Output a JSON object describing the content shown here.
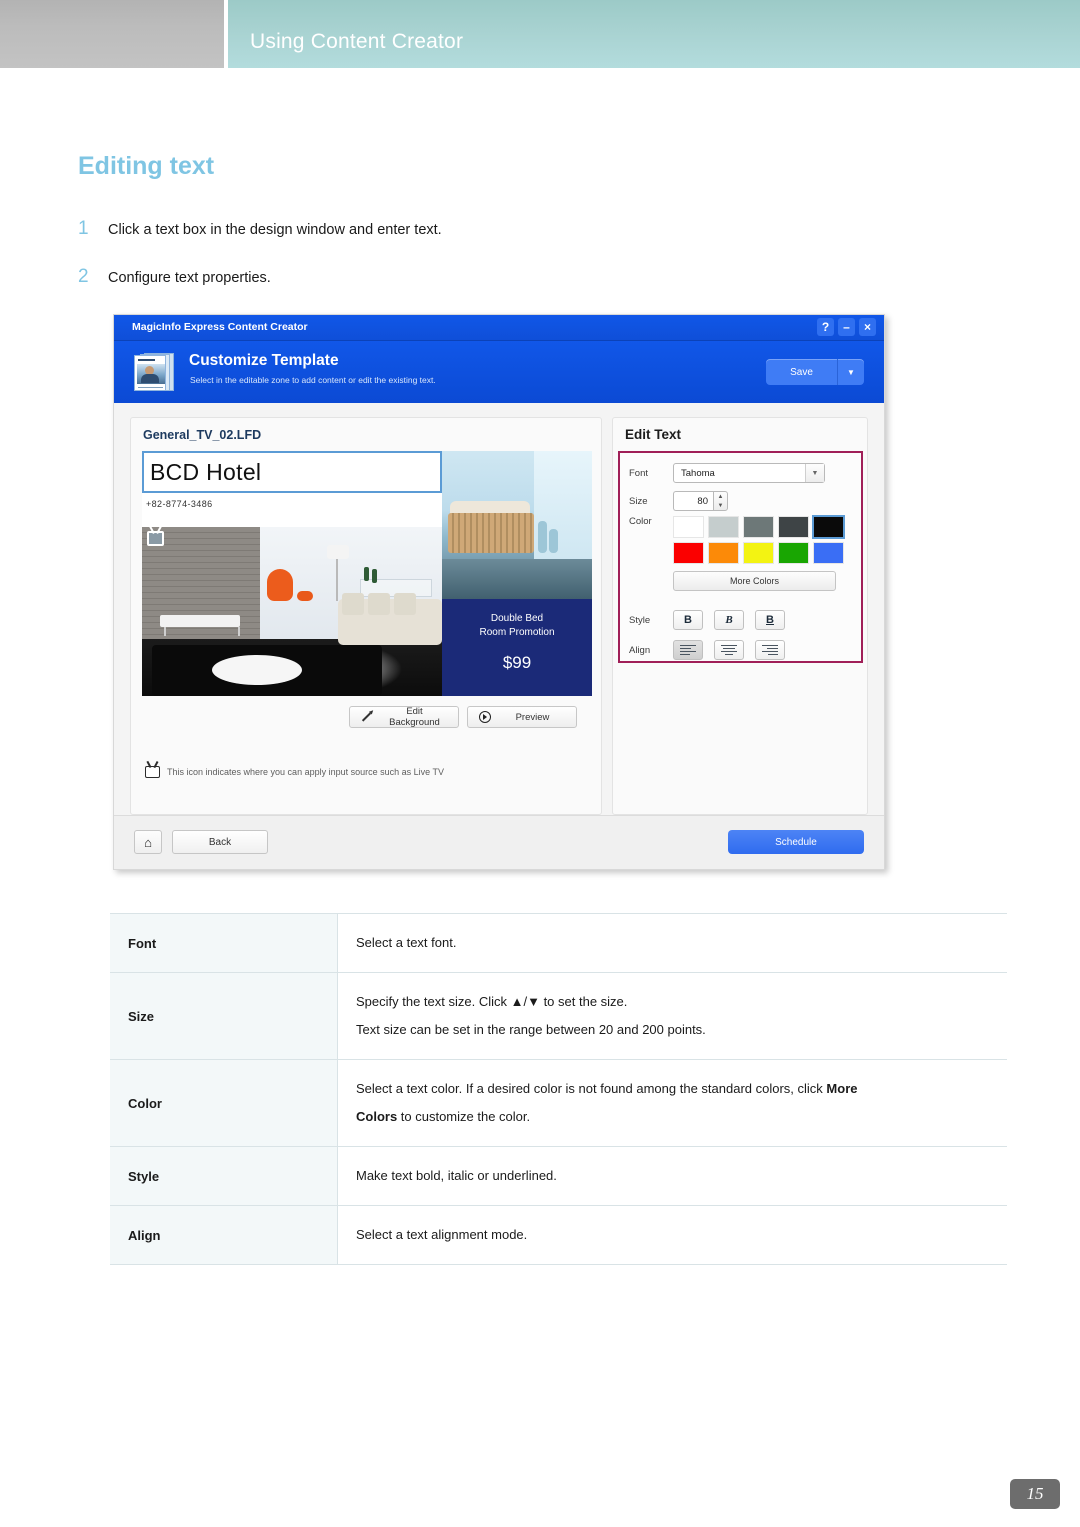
{
  "header": {
    "title": "Using Content Creator"
  },
  "section": {
    "title": "Editing text",
    "steps": [
      {
        "num": "1",
        "text": "Click a text box in the design window and enter text."
      },
      {
        "num": "2",
        "text": "Configure text properties."
      }
    ]
  },
  "app": {
    "title_bar": {
      "app_title": "MagicInfo Express Content Creator",
      "help_label": "?",
      "minimize_label": "–",
      "close_label": "×"
    },
    "head": {
      "title": "Customize Template",
      "subtitle": "Select in the editable zone to add content or edit the existing text.",
      "save_label": "Save",
      "save_arrow": "▼"
    },
    "left_panel": {
      "file_name": "General_TV_02.LFD",
      "text_box_value": "BCD Hotel",
      "phone": "+82-8774-3486",
      "promo": {
        "line1": "Double Bed",
        "line2": "Room Promotion",
        "price": "$99"
      },
      "edit_background_label": "Edit Background",
      "preview_label": "Preview",
      "hint": "This icon indicates where you can apply input source such as Live TV"
    },
    "edit_text": {
      "title": "Edit Text",
      "font_label": "Font",
      "font_value": "Tahoma",
      "font_dropdown_arrow": "▼",
      "size_label": "Size",
      "size_value": "80",
      "size_up": "▲",
      "size_down": "▼",
      "color_label": "Color",
      "colors_row1": [
        "#ffffff",
        "#c5cdcd",
        "#6d7878",
        "#3e4446",
        "#0a0a0a"
      ],
      "colors_row2": [
        "#fb0000",
        "#fc8a08",
        "#f3f312",
        "#19a602",
        "#3a6ef5"
      ],
      "selected_color": "#0a0a0a",
      "more_colors_label": "More Colors",
      "style_label": "Style",
      "style_bold": "B",
      "style_italic": "B",
      "style_underline": "B",
      "align_label": "Align",
      "align_selected": "left"
    },
    "footer": {
      "home_icon": "⌂",
      "back_label": "Back",
      "schedule_label": "Schedule"
    }
  },
  "desc_table": {
    "rows": [
      {
        "key": "Font",
        "lines": [
          {
            "parts": [
              {
                "t": "Select a text font.",
                "b": false
              }
            ]
          }
        ]
      },
      {
        "key": "Size",
        "lines": [
          {
            "parts": [
              {
                "t": "Specify the text size. Click ▲/▼ to set the size.",
                "b": false
              }
            ]
          },
          {
            "parts": [
              {
                "t": "Text size can be set in the range between 20 and 200 points.",
                "b": false
              }
            ]
          }
        ]
      },
      {
        "key": "Color",
        "lines": [
          {
            "parts": [
              {
                "t": "Select a text color. If a desired color is not found among the standard colors, click ",
                "b": false
              },
              {
                "t": "More",
                "b": true
              }
            ]
          },
          {
            "parts": [
              {
                "t": "Colors",
                "b": true
              },
              {
                "t": " to customize the color.",
                "b": false
              }
            ]
          }
        ]
      },
      {
        "key": "Style",
        "lines": [
          {
            "parts": [
              {
                "t": "Make text bold, italic or underlined.",
                "b": false
              }
            ]
          }
        ]
      },
      {
        "key": "Align",
        "lines": [
          {
            "parts": [
              {
                "t": "Select a text alignment mode.",
                "b": false
              }
            ]
          }
        ]
      }
    ]
  },
  "page_number": "15"
}
